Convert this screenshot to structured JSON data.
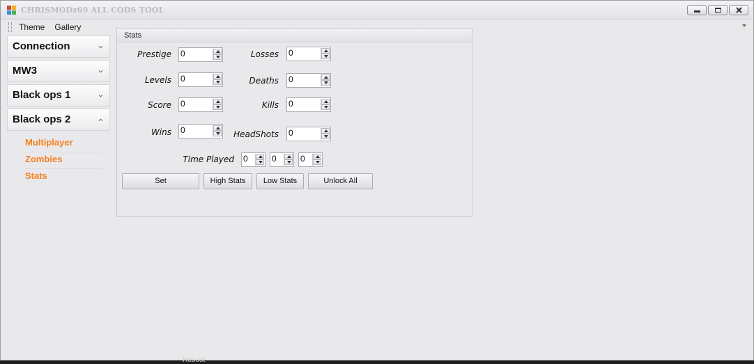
{
  "window": {
    "title": "CHRISMODz69 ALL CODS TOOL"
  },
  "menubar": {
    "items": [
      "Theme",
      "Gallery"
    ]
  },
  "sidebar": {
    "sections": [
      {
        "label": "Connection",
        "expanded": false
      },
      {
        "label": "MW3",
        "expanded": false
      },
      {
        "label": "Black ops 1",
        "expanded": false
      },
      {
        "label": "Black ops 2",
        "expanded": true
      }
    ],
    "sub_items": [
      "Multiplayer",
      "Zombies",
      "Stats"
    ],
    "sub_item_color": "#f5811f"
  },
  "stats": {
    "group_title": "Stats",
    "prestige": {
      "label": "Prestige",
      "value": "0"
    },
    "levels": {
      "label": "Levels",
      "value": "0"
    },
    "score": {
      "label": "Score",
      "value": "0"
    },
    "wins": {
      "label": "Wins",
      "value": "0"
    },
    "losses": {
      "label": "Losses",
      "value": "0"
    },
    "deaths": {
      "label": "Deaths",
      "value": "0"
    },
    "kills": {
      "label": "Kills",
      "value": "0"
    },
    "headshots": {
      "label": "HeadShots",
      "value": "0"
    },
    "time_played": {
      "label": "Time Played",
      "values": [
        "0",
        "0",
        "0"
      ]
    }
  },
  "buttons": {
    "set": "Set",
    "high_stats": "High Stats",
    "low_stats": "Low Stats",
    "unlock_all": "Unlock All"
  },
  "taskbar": {
    "ghost_text": "Reboot"
  }
}
